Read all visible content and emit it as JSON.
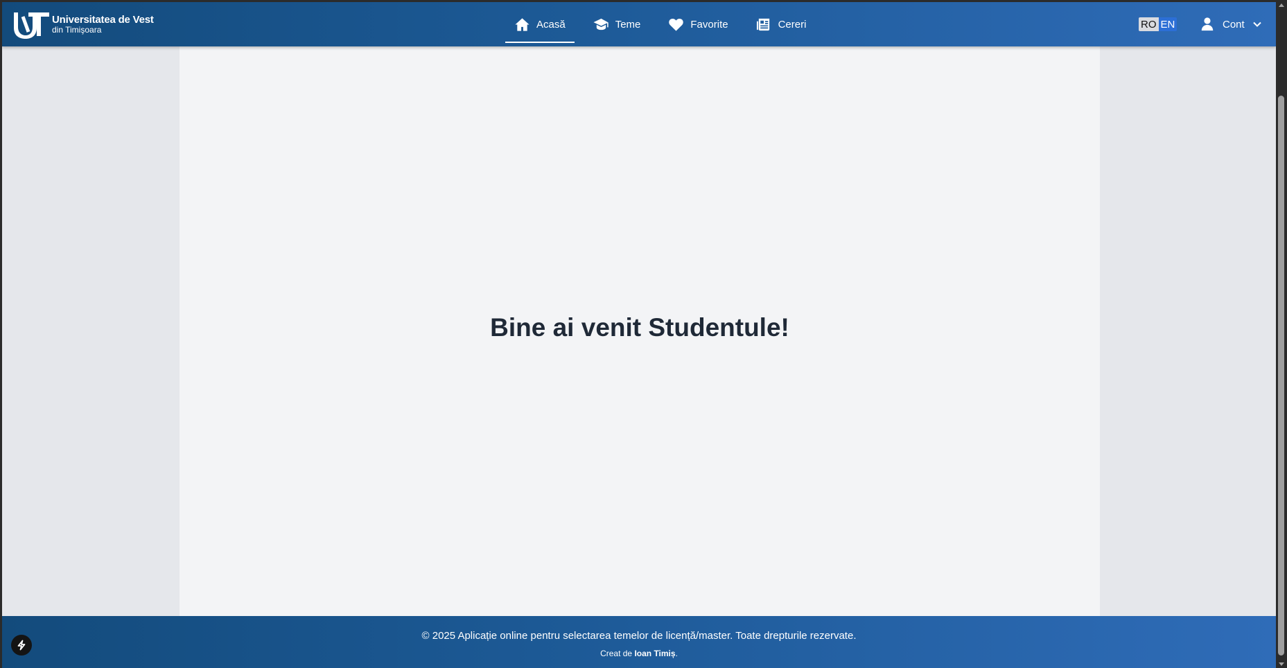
{
  "header": {
    "logo": {
      "line1": "Universitatea de Vest",
      "line2": "din Timişoara"
    },
    "nav": [
      {
        "label": "Acasă",
        "icon": "home-icon",
        "active": true
      },
      {
        "label": "Teme",
        "icon": "graduation-cap-icon",
        "active": false
      },
      {
        "label": "Favorite",
        "icon": "heart-icon",
        "active": false
      },
      {
        "label": "Cereri",
        "icon": "newspaper-icon",
        "active": false
      }
    ],
    "language": {
      "options": [
        "RO",
        "EN"
      ],
      "selected": "RO"
    },
    "account": {
      "label": "Cont",
      "icon": "user-icon"
    }
  },
  "main": {
    "welcome": "Bine ai venit Studentule!"
  },
  "footer": {
    "copyright": "© 2025 Aplicație online pentru selectarea temelor de licență/master. Toate drepturile rezervate.",
    "credit_prefix": "Creat de ",
    "credit_author": "Ioan Timiș",
    "credit_suffix": "."
  },
  "colors": {
    "header_gradient_start": "#134b7c",
    "header_gradient_end": "#2f6cb8",
    "content_bg": "#f3f4f6",
    "side_bg": "#e5e7eb",
    "heading": "#1f2937",
    "lang_active_bg": "#d9dbe0",
    "lang_inactive_bg": "#2c6fd6"
  },
  "floating": {
    "icon": "lightning-icon"
  }
}
